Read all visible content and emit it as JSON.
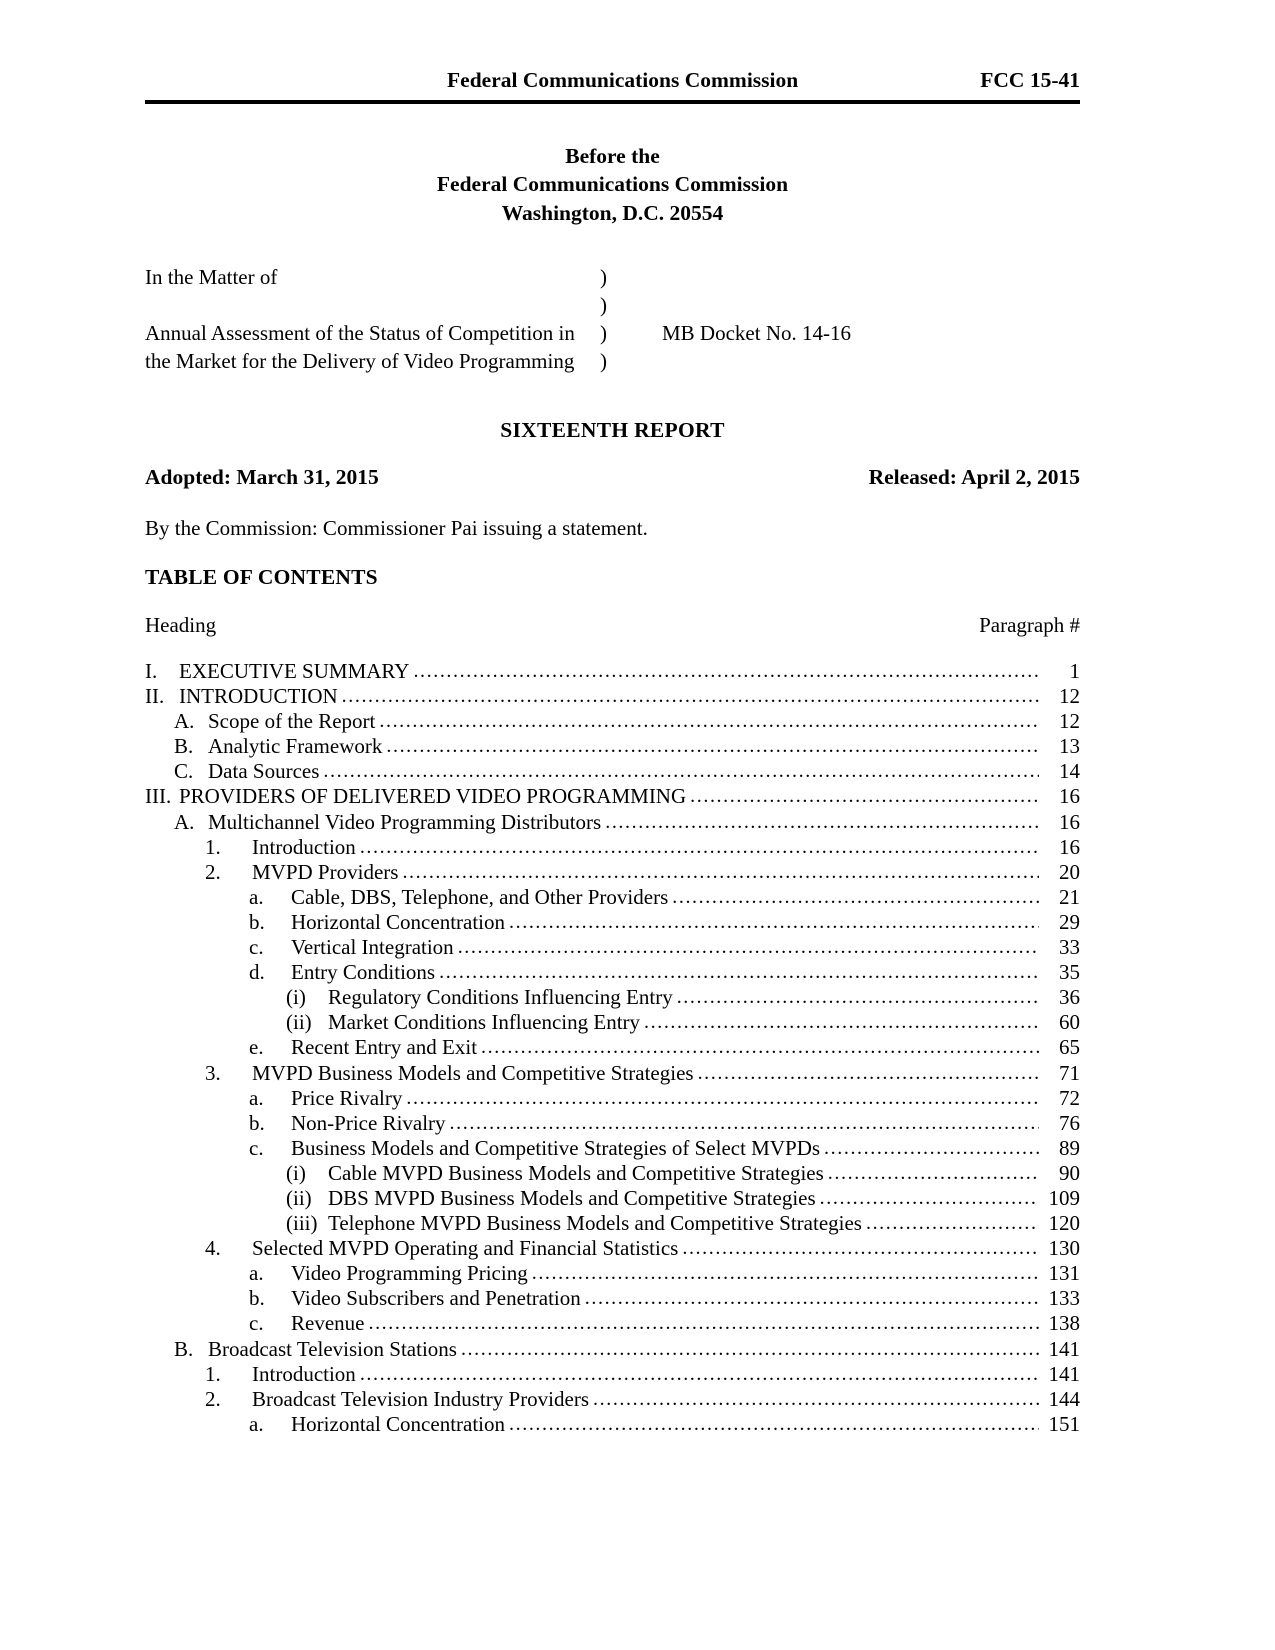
{
  "header": {
    "title": "Federal Communications Commission",
    "doc_number": "FCC 15-41"
  },
  "before_block": {
    "line1": "Before the",
    "line2": "Federal Communications Commission",
    "line3": "Washington, D.C. 20554"
  },
  "matter": {
    "in_the_matter_of": "In the Matter of",
    "paren": ")",
    "subject_line1": "Annual Assessment of the Status of Competition in",
    "subject_line2": "the Market for the Delivery of Video Programming",
    "docket": "MB Docket No. 14-16"
  },
  "report": {
    "title": "SIXTEENTH REPORT",
    "adopted": "Adopted:  March 31, 2015",
    "released": "Released:  April 2, 2015",
    "by_line": "By the Commission:  Commissioner Pai issuing a statement."
  },
  "toc": {
    "title": "TABLE OF CONTENTS",
    "caption_left": "Heading",
    "caption_right": "Paragraph #",
    "leader_dots": "..................................................................................................................................................................................................",
    "entries": [
      {
        "level": 1,
        "number": "I.",
        "label": "EXECUTIVE SUMMARY",
        "page": "1"
      },
      {
        "level": 1,
        "number": "II.",
        "label": "INTRODUCTION",
        "page": "12"
      },
      {
        "level": 2,
        "number": "A.",
        "label": "Scope of the Report",
        "page": "12"
      },
      {
        "level": 2,
        "number": "B.",
        "label": "Analytic Framework",
        "page": "13"
      },
      {
        "level": 2,
        "number": "C.",
        "label": "Data Sources",
        "page": "14"
      },
      {
        "level": 1,
        "number": "III.",
        "label": "PROVIDERS OF DELIVERED VIDEO PROGRAMMING",
        "page": "16"
      },
      {
        "level": 2,
        "number": "A.",
        "label": "Multichannel Video Programming Distributors",
        "page": "16"
      },
      {
        "level": 3,
        "number": "1.",
        "label": "Introduction",
        "page": "16"
      },
      {
        "level": 3,
        "number": "2.",
        "label": "MVPD Providers",
        "page": "20"
      },
      {
        "level": 4,
        "number": "a.",
        "label": "Cable, DBS, Telephone, and Other Providers",
        "page": "21"
      },
      {
        "level": 4,
        "number": "b.",
        "label": "Horizontal Concentration",
        "page": "29"
      },
      {
        "level": 4,
        "number": "c.",
        "label": "Vertical Integration",
        "page": "33"
      },
      {
        "level": 4,
        "number": "d.",
        "label": "Entry Conditions",
        "page": "35"
      },
      {
        "level": 5,
        "number": "(i)",
        "label": "Regulatory Conditions Influencing Entry",
        "page": "36"
      },
      {
        "level": 5,
        "number": "(ii)",
        "label": "Market Conditions Influencing Entry",
        "page": "60"
      },
      {
        "level": 4,
        "number": "e.",
        "label": "Recent Entry and Exit",
        "page": "65"
      },
      {
        "level": 3,
        "number": "3.",
        "label": "MVPD Business Models and Competitive Strategies",
        "page": "71"
      },
      {
        "level": 4,
        "number": "a.",
        "label": "Price Rivalry",
        "page": "72"
      },
      {
        "level": 4,
        "number": "b.",
        "label": "Non-Price Rivalry",
        "page": "76"
      },
      {
        "level": 4,
        "number": "c.",
        "label": "Business Models and Competitive Strategies of Select MVPDs",
        "page": "89"
      },
      {
        "level": 5,
        "number": "(i)",
        "label": "Cable MVPD Business Models and Competitive Strategies",
        "page": "90"
      },
      {
        "level": 5,
        "number": "(ii)",
        "label": "DBS MVPD Business Models and Competitive Strategies",
        "page": "109"
      },
      {
        "level": 5,
        "number": "(iii)",
        "label": "Telephone MVPD Business Models and Competitive Strategies",
        "page": "120"
      },
      {
        "level": 3,
        "number": "4.",
        "label": "Selected MVPD Operating and Financial Statistics",
        "page": "130"
      },
      {
        "level": 4,
        "number": "a.",
        "label": "Video Programming Pricing",
        "page": "131"
      },
      {
        "level": 4,
        "number": "b.",
        "label": "Video Subscribers and Penetration",
        "page": "133"
      },
      {
        "level": 4,
        "number": "c.",
        "label": "Revenue",
        "page": "138"
      },
      {
        "level": 2,
        "number": "B.",
        "label": "Broadcast Television Stations",
        "page": "141"
      },
      {
        "level": 3,
        "number": "1.",
        "label": "Introduction",
        "page": "141"
      },
      {
        "level": 3,
        "number": "2.",
        "label": "Broadcast Television Industry Providers",
        "page": "144"
      },
      {
        "level": 4,
        "number": "a.",
        "label": "Horizontal Concentration",
        "page": "151"
      }
    ]
  }
}
